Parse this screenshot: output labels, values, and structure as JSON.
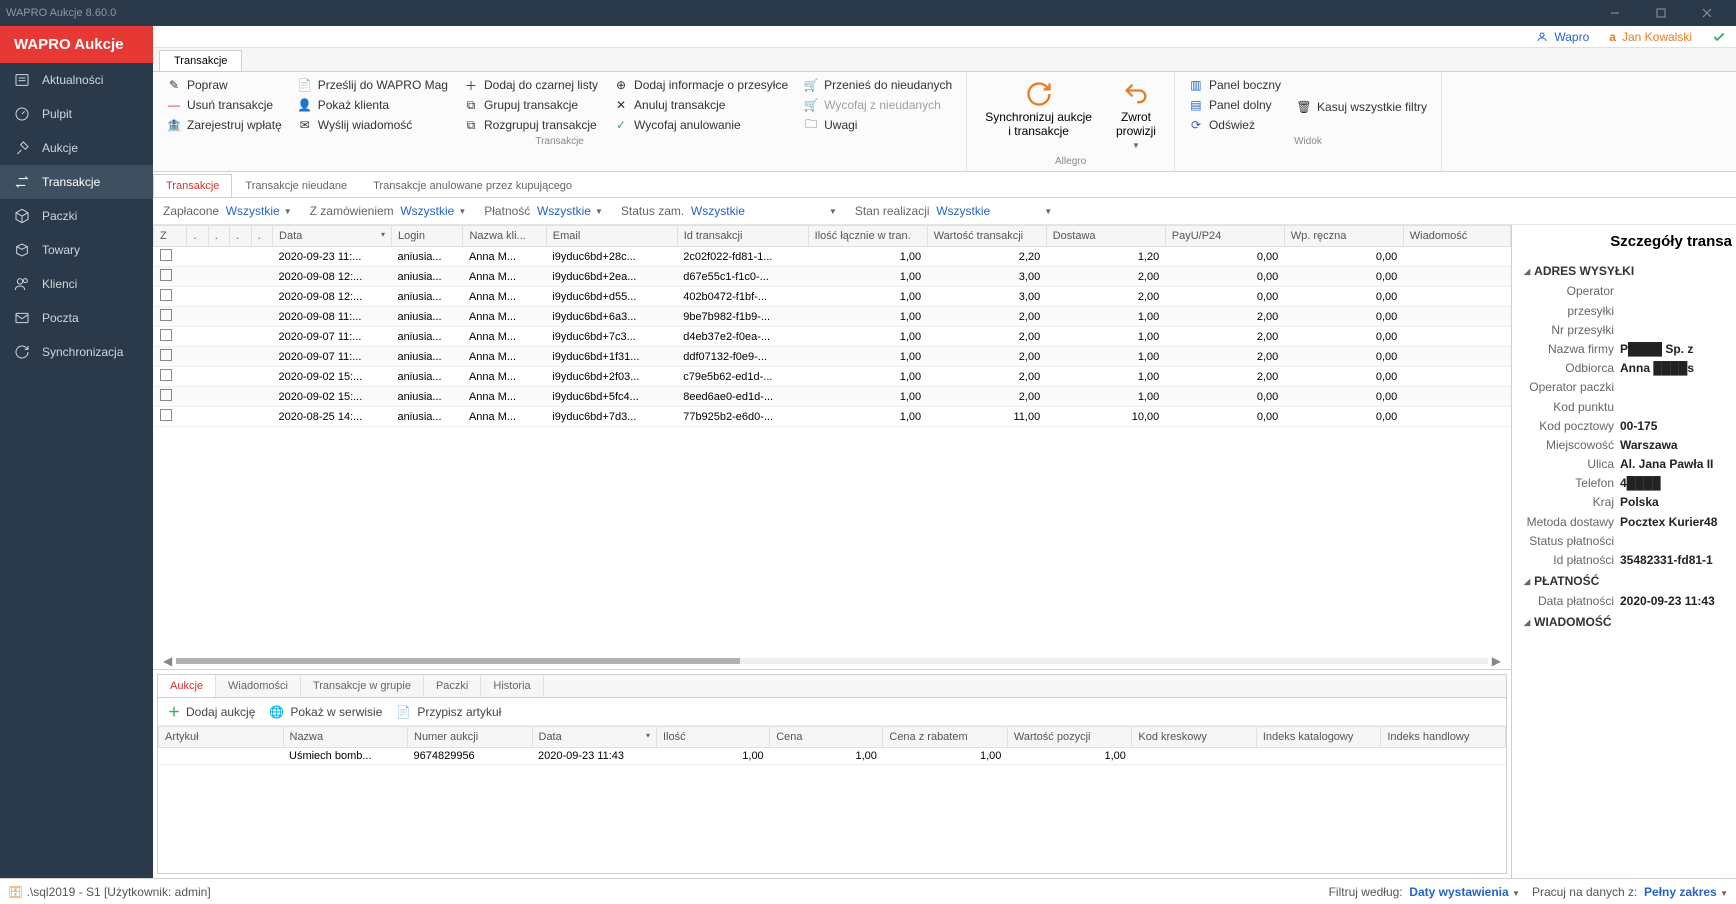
{
  "app": {
    "title": "WAPRO Aukcje 8.60.0",
    "brand": "WAPRO Aukcje"
  },
  "user_bar": {
    "wapro": "Wapro",
    "allegro": "Jan Kowalski"
  },
  "sidebar": {
    "items": [
      {
        "id": "news",
        "label": "Aktualności"
      },
      {
        "id": "dashboard",
        "label": "Pulpit"
      },
      {
        "id": "auctions",
        "label": "Aukcje"
      },
      {
        "id": "transactions",
        "label": "Transakcje"
      },
      {
        "id": "packages",
        "label": "Paczki"
      },
      {
        "id": "goods",
        "label": "Towary"
      },
      {
        "id": "clients",
        "label": "Klienci"
      },
      {
        "id": "mail",
        "label": "Poczta"
      },
      {
        "id": "sync",
        "label": "Synchronizacja"
      }
    ],
    "active": "transactions"
  },
  "main_tab": "Transakcje",
  "ribbon": {
    "group1": {
      "label": "Transakcje",
      "row1": [
        "Popraw",
        "Prześlij do WAPRO Mag",
        "Dodaj do czarnej listy",
        "Dodaj informacje o przesyłce",
        "Przenieś do nieudanych"
      ],
      "row2": [
        "Usuń transakcje",
        "Pokaż klienta",
        "Grupuj transakcje",
        "Anuluj transakcje",
        "Wycofaj z nieudanych"
      ],
      "row3": [
        "Zarejestruj wpłatę",
        "Wyślij wiadomość",
        "Rozgrupuj transakcje",
        "Wycofaj anulowanie",
        "Uwagi"
      ]
    },
    "group2": {
      "label": "Allegro",
      "sync": "Synchronizuj aukcje\ni transakcje",
      "refund": "Zwrot\nprowizji"
    },
    "group3": {
      "label": "Widok",
      "row1": [
        "Panel boczny"
      ],
      "row2": [
        "Panel dolny",
        "Kasuj wszystkie filtry"
      ],
      "row3": [
        "Odśwież"
      ]
    }
  },
  "sub_tabs": [
    "Transakcje",
    "Transakcje nieudane",
    "Transakcje anulowane przez kupującego"
  ],
  "sub_tab_active": 0,
  "filters": {
    "paid": {
      "label": "Zapłacone",
      "value": "Wszystkie"
    },
    "order": {
      "label": "Z zamówieniem",
      "value": "Wszystkie"
    },
    "payment": {
      "label": "Płatność",
      "value": "Wszystkie"
    },
    "order_status": {
      "label": "Status zam.",
      "value": "Wszystkie"
    },
    "realization": {
      "label": "Stan realizacji",
      "value": "Wszystkie"
    }
  },
  "grid": {
    "columns": [
      "Z",
      ".",
      ".",
      ".",
      ".",
      "Data",
      "Login",
      "Nazwa kli...",
      "Email",
      "Id transakcji",
      "Ilość łącznie w tran.",
      "Wartość transakcji",
      "Dostawa",
      "PayU/P24",
      "Wp. ręczna",
      "Wiadomość"
    ],
    "rows": [
      {
        "date": "2020-09-23 11:...",
        "login": "aniusia...",
        "name": "Anna M...",
        "email": "i9yduc6bd+28c...",
        "tid": "2c02f022-fd81-1...",
        "qty": "1,00",
        "val": "2,20",
        "ship": "1,20",
        "payu": "0,00",
        "wp": "0,00"
      },
      {
        "date": "2020-09-08 12:...",
        "login": "aniusia...",
        "name": "Anna M...",
        "email": "i9yduc6bd+2ea...",
        "tid": "d67e55c1-f1c0-...",
        "qty": "1,00",
        "val": "3,00",
        "ship": "2,00",
        "payu": "0,00",
        "wp": "0,00"
      },
      {
        "date": "2020-09-08 12:...",
        "login": "aniusia...",
        "name": "Anna M...",
        "email": "i9yduc6bd+d55...",
        "tid": "402b0472-f1bf-...",
        "qty": "1,00",
        "val": "3,00",
        "ship": "2,00",
        "payu": "0,00",
        "wp": "0,00"
      },
      {
        "date": "2020-09-08 11:...",
        "login": "aniusia...",
        "name": "Anna M...",
        "email": "i9yduc6bd+6a3...",
        "tid": "9be7b982-f1b9-...",
        "qty": "1,00",
        "val": "2,00",
        "ship": "1,00",
        "payu": "2,00",
        "wp": "0,00"
      },
      {
        "date": "2020-09-07 11:...",
        "login": "aniusia...",
        "name": "Anna M...",
        "email": "i9yduc6bd+7c3...",
        "tid": "d4eb37e2-f0ea-...",
        "qty": "1,00",
        "val": "2,00",
        "ship": "1,00",
        "payu": "2,00",
        "wp": "0,00"
      },
      {
        "date": "2020-09-07 11:...",
        "login": "aniusia...",
        "name": "Anna M...",
        "email": "i9yduc6bd+1f31...",
        "tid": "ddf07132-f0e9-...",
        "qty": "1,00",
        "val": "2,00",
        "ship": "1,00",
        "payu": "2,00",
        "wp": "0,00"
      },
      {
        "date": "2020-09-02 15:...",
        "login": "aniusia...",
        "name": "Anna M...",
        "email": "i9yduc6bd+2f03...",
        "tid": "c79e5b62-ed1d-...",
        "qty": "1,00",
        "val": "2,00",
        "ship": "1,00",
        "payu": "2,00",
        "wp": "0,00"
      },
      {
        "date": "2020-09-02 15:...",
        "login": "aniusia...",
        "name": "Anna M...",
        "email": "i9yduc6bd+5fc4...",
        "tid": "8eed6ae0-ed1d-...",
        "qty": "1,00",
        "val": "2,00",
        "ship": "1,00",
        "payu": "0,00",
        "wp": "0,00"
      },
      {
        "date": "2020-08-25 14:...",
        "login": "aniusia...",
        "name": "Anna M...",
        "email": "i9yduc6bd+7d3...",
        "tid": "77b925b2-e6d0-...",
        "qty": "1,00",
        "val": "11,00",
        "ship": "10,00",
        "payu": "0,00",
        "wp": "0,00"
      }
    ]
  },
  "bottom": {
    "tabs": [
      "Aukcje",
      "Wiadomości",
      "Transakcje w grupie",
      "Paczki",
      "Historia"
    ],
    "active": 0,
    "toolbar": [
      "Dodaj aukcję",
      "Pokaż w serwisie",
      "Przypisz artykuł"
    ],
    "columns": [
      "Artykuł",
      "Nazwa",
      "Numer aukcji",
      "Data",
      "Ilość",
      "Cena",
      "Cena z rabatem",
      "Wartość pozycji",
      "Kod kreskowy",
      "Indeks katalogowy",
      "Indeks handlowy"
    ],
    "row": {
      "art": "",
      "name": "Uśmiech bomb...",
      "num": "9674829956",
      "date": "2020-09-23 11:43",
      "qty": "1,00",
      "price": "1,00",
      "disc": "1,00",
      "val": "1,00"
    }
  },
  "detail": {
    "title": "Szczegóły transa",
    "sections": {
      "ship": "ADRES WYSYŁKI",
      "payment": "PŁATNOŚĆ",
      "message": "WIADOMOŚĆ"
    },
    "ship_rows": [
      {
        "lbl": "Operator przesyłki",
        "val": ""
      },
      {
        "lbl": "Nr przesyłki",
        "val": ""
      },
      {
        "lbl": "Nazwa firmy",
        "val": "P████  Sp. z"
      },
      {
        "lbl": "Odbiorca",
        "val": "Anna ████s"
      },
      {
        "lbl": "Operator paczki",
        "val": ""
      },
      {
        "lbl": "Kod punktu",
        "val": ""
      },
      {
        "lbl": "Kod pocztowy",
        "val": "00-175"
      },
      {
        "lbl": "Miejscowość",
        "val": "Warszawa"
      },
      {
        "lbl": "Ulica",
        "val": "Al. Jana Pawła II"
      },
      {
        "lbl": "Telefon",
        "val": "4████"
      },
      {
        "lbl": "Kraj",
        "val": "Polska"
      },
      {
        "lbl": "Metoda dostawy",
        "val": "Pocztex Kurier48"
      },
      {
        "lbl": "Status płatności",
        "val": ""
      },
      {
        "lbl": "Id płatności",
        "val": "35482331-fd81-1"
      }
    ],
    "payment_rows": [
      {
        "lbl": "Data płatności",
        "val": "2020-09-23 11:43"
      }
    ]
  },
  "status": {
    "left": ".\\sql2019 - S1 [Użytkownik: admin]",
    "filter_label": "Filtruj według:",
    "filter_value": "Daty wystawienia",
    "data_label": "Pracuj na danych z:",
    "data_value": "Pełny zakres"
  }
}
